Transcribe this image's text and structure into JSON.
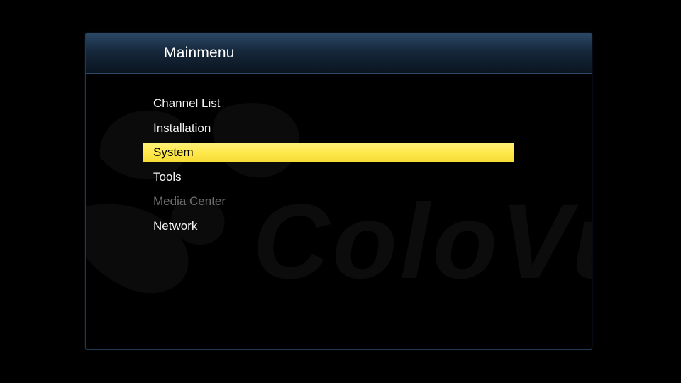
{
  "menu": {
    "title": "Mainmenu",
    "items": [
      {
        "label": "Channel List",
        "state": "normal"
      },
      {
        "label": "Installation",
        "state": "normal"
      },
      {
        "label": "System",
        "state": "selected"
      },
      {
        "label": "Tools",
        "state": "normal"
      },
      {
        "label": "Media Center",
        "state": "disabled"
      },
      {
        "label": "Network",
        "state": "normal"
      }
    ]
  },
  "watermark": {
    "text": "ColoVu",
    "icon": "colovu-logo-icon"
  },
  "colors": {
    "background": "#000000",
    "title_bar": "#1c3148",
    "highlight": "#ffe84a",
    "item_text": "#f2f2f2",
    "disabled_text": "#6e6e6e",
    "border": "#1f3a52"
  }
}
